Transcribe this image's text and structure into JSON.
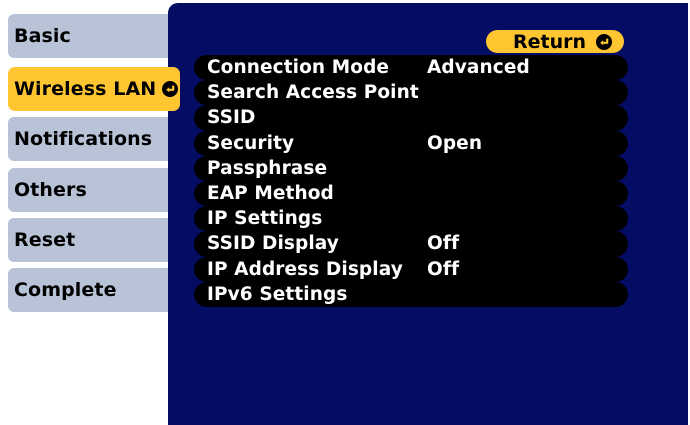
{
  "sidebar": {
    "tabs": [
      {
        "label": "Basic",
        "active": false
      },
      {
        "label": "Wireless LAN",
        "active": true,
        "icon": "enter-icon"
      },
      {
        "label": "Notifications",
        "active": false
      },
      {
        "label": "Others",
        "active": false
      },
      {
        "label": "Reset",
        "active": false
      },
      {
        "label": "Complete",
        "active": false
      }
    ]
  },
  "panel": {
    "return_label": "Return",
    "return_icon": "enter-icon",
    "items": [
      {
        "label": "Connection Mode",
        "value": "Advanced"
      },
      {
        "label": "Search Access Point",
        "value": ""
      },
      {
        "label": "SSID",
        "value": ""
      },
      {
        "label": "Security",
        "value": "Open"
      },
      {
        "label": "Passphrase",
        "value": ""
      },
      {
        "label": "EAP Method",
        "value": ""
      },
      {
        "label": "IP Settings",
        "value": ""
      },
      {
        "label": "SSID Display",
        "value": "Off"
      },
      {
        "label": "IP Address Display",
        "value": "Off"
      },
      {
        "label": "IPv6 Settings",
        "value": ""
      }
    ]
  },
  "colors": {
    "panel_background": "#050c63",
    "tab_inactive": "#b9c3d7",
    "highlight": "#ffc632",
    "row_background": "#000000",
    "text_light": "#ffffff"
  }
}
